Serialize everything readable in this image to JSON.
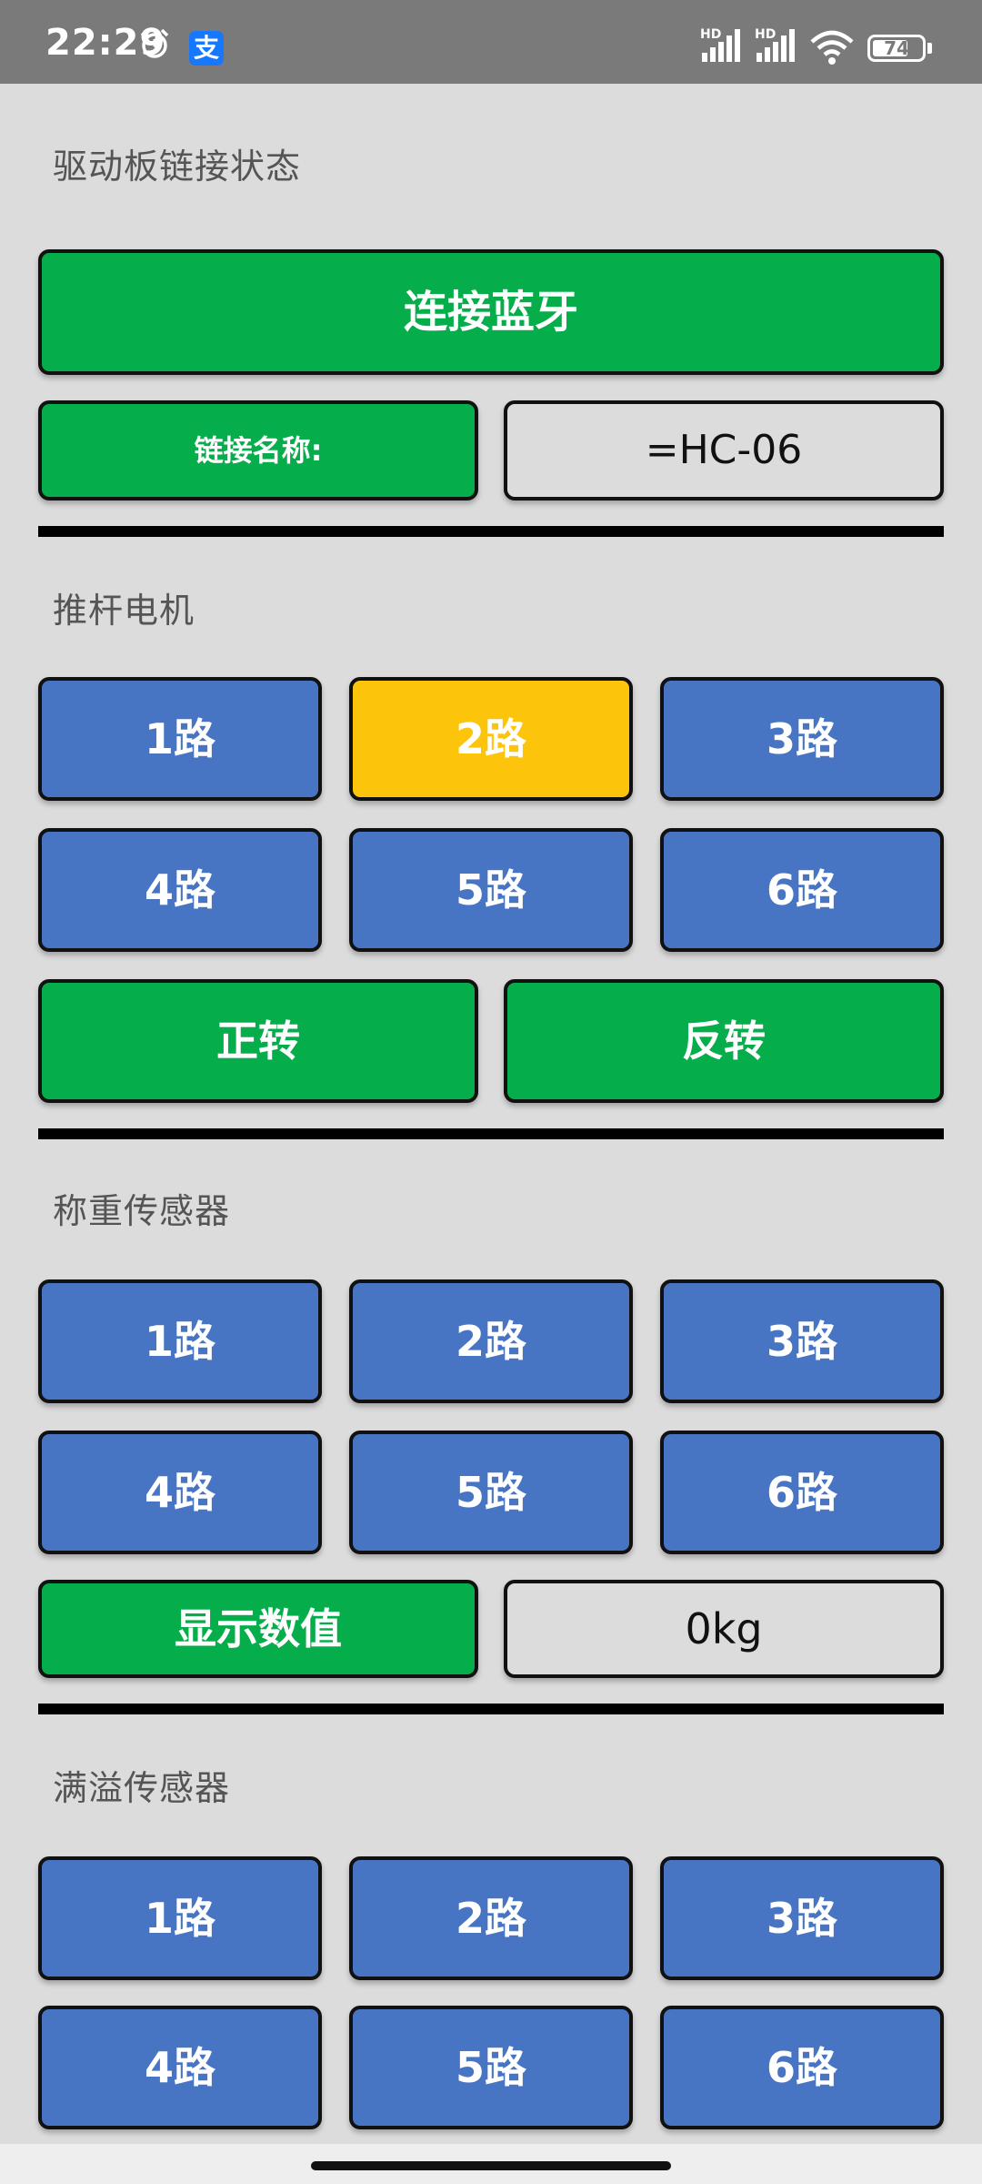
{
  "status_bar": {
    "time": "22:29",
    "alarm_icon": "alarm-clock-icon",
    "app_icon": "alipay-icon",
    "app_glyph": "支",
    "signal1_label": "HD",
    "signal2_label": "HD",
    "wifi_icon": "wifi-icon",
    "battery_level": "74"
  },
  "board_status": {
    "title": "驱动板链接状态",
    "connect_button": "连接蓝牙",
    "link_name_label": "链接名称:",
    "link_name_value": "=HC-06"
  },
  "push_motor": {
    "title": "推杆电机",
    "channels": [
      "1路",
      "2路",
      "3路",
      "4路",
      "5路",
      "6路"
    ],
    "selected_channel": "2路",
    "forward_button": "正转",
    "reverse_button": "反转"
  },
  "weight_sensor": {
    "title": "称重传感器",
    "channels": [
      "1路",
      "2路",
      "3路",
      "4路",
      "5路",
      "6路"
    ],
    "show_value_button": "显示数值",
    "value": "0kg"
  },
  "overflow_sensor": {
    "title": "满溢传感器",
    "channels": [
      "1路",
      "2路",
      "3路",
      "4路",
      "5路",
      "6路"
    ]
  },
  "colors": {
    "green": "#05ad4b",
    "blue": "#4775c4",
    "yellow": "#fcc40b",
    "background": "#dcdcdc"
  }
}
